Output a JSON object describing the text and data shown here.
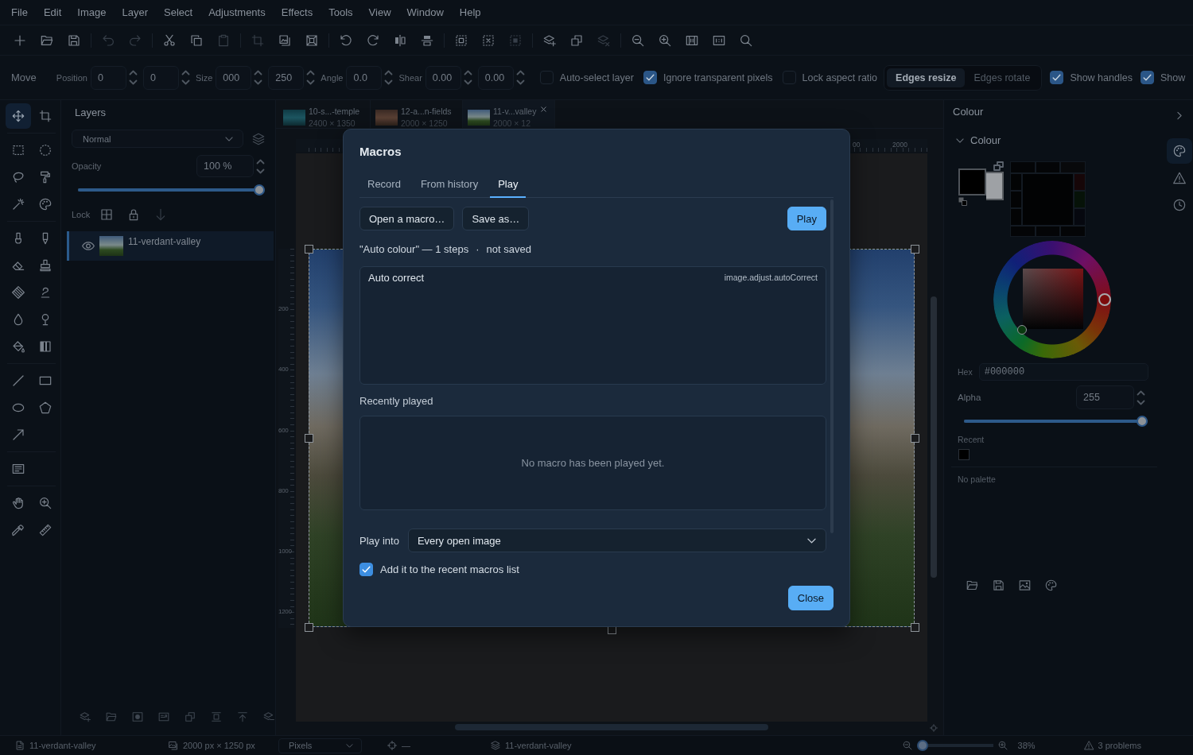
{
  "menu_bar": [
    "File",
    "Edit",
    "Image",
    "Layer",
    "Select",
    "Adjustments",
    "Effects",
    "Tools",
    "View",
    "Window",
    "Help"
  ],
  "toolbar": [
    [
      {
        "disabled": false
      },
      {
        "disabled": false
      },
      {
        "disabled": false
      }
    ],
    [
      {
        "disabled": true
      },
      {
        "disabled": true
      }
    ],
    [
      {
        "disabled": false
      },
      {
        "disabled": false
      },
      {
        "disabled": true
      }
    ],
    [
      {
        "disabled": true
      },
      {
        "disabled": false
      },
      {
        "disabled": false
      }
    ],
    [
      {
        "disabled": false
      },
      {
        "disabled": false
      },
      {
        "disabled": false
      },
      {
        "disabled": false
      }
    ],
    [
      {
        "disabled": false
      },
      {
        "disabled": false
      },
      {
        "disabled": true
      }
    ],
    [
      {
        "disabled": false
      },
      {
        "disabled": false
      },
      {
        "disabled": true
      }
    ],
    [
      {
        "disabled": false
      },
      {
        "disabled": false
      },
      {
        "disabled": false
      },
      {
        "disabled": false
      },
      {
        "disabled": false
      }
    ]
  ],
  "tool_options": {
    "tool": "Move",
    "fields": [
      {
        "label": "Position",
        "value": "0"
      },
      {
        "value": "0"
      },
      {
        "label": "Size",
        "value": "000"
      },
      {
        "value": "250"
      },
      {
        "label": "Angle",
        "value": "0.0"
      },
      {
        "label": "Shear",
        "value": "0.00"
      },
      {
        "value": "0.00"
      }
    ],
    "checks": [
      {
        "label": "Auto-select layer",
        "checked": false
      },
      {
        "label": "Ignore transparent pixels",
        "checked": true
      },
      {
        "label": "Lock aspect ratio",
        "checked": false
      }
    ],
    "edge_modes": [
      {
        "label": "Edges resize",
        "selected": true
      },
      {
        "label": "Edges rotate",
        "selected": false
      }
    ],
    "view_checks": [
      {
        "label": "Show handles",
        "checked": true
      },
      {
        "label": "Show",
        "checked": true
      }
    ]
  },
  "tools": [
    {
      "selected": true
    },
    {
      "selected": false
    },
    {
      "selected": false
    },
    {
      "selected": false
    },
    {
      "selected": false
    },
    {
      "selected": false
    },
    {
      "selected": false
    },
    {
      "selected": false
    },
    {
      "selected": false
    },
    {
      "selected": false
    },
    {
      "selected": false
    },
    {
      "selected": false
    },
    {
      "selected": false
    },
    {
      "selected": false
    },
    {
      "selected": false
    },
    {
      "selected": false
    },
    {
      "selected": false
    },
    {
      "selected": false
    },
    {
      "selected": false
    },
    {
      "selected": false
    },
    {
      "selected": false
    },
    {
      "selected": false
    },
    {
      "selected": false
    },
    {
      "selected": false
    },
    {
      "selected": false
    },
    {
      "selected": false
    },
    {
      "selected": false
    },
    {
      "selected": false
    }
  ],
  "layers_panel": {
    "title": "Layers",
    "blend_mode": "Normal",
    "opacity_label": "Opacity",
    "opacity_value": "100 %",
    "opacity_slider": {
      "level": 1
    },
    "lock_label": "Lock",
    "layers": [
      {
        "name": "11-verdant-valley",
        "selected": true,
        "visible": true
      }
    ]
  },
  "documents": [
    {
      "name": "10-s...-temple",
      "size": "2400 × 1350",
      "selected": false
    },
    {
      "name": "12-a...n-fields",
      "size": "2000 × 1250",
      "selected": false
    },
    {
      "name": "11-v...valley",
      "size": "2000 × 12",
      "selected": true
    }
  ],
  "rulers": {
    "horizontal": [
      "00",
      "2000"
    ],
    "vertical": [
      "200",
      "400",
      "600",
      "800",
      "1000",
      "1200"
    ]
  },
  "colour_panel": {
    "title": "Colour",
    "section": {
      "label": "Colour",
      "expanded": true
    },
    "primary": {
      "color": "#000000"
    },
    "secondary": {
      "color": "#9ea1a5"
    },
    "variations": [
      {
        "color": "#040507"
      },
      {
        "color": "#040507"
      },
      {
        "color": "#08090b"
      },
      {
        "color": "#030405"
      },
      {
        "color": "#030405"
      },
      {
        "color": "#030405"
      },
      {
        "color": "#020304"
      },
      {
        "color": "#160608"
      },
      {
        "color": "#061208"
      },
      {
        "color": "#06080f"
      },
      {
        "color": "#040507"
      },
      {
        "color": "#040507"
      },
      {
        "color": "#040507"
      }
    ],
    "hex_label": "Hex",
    "hex_value": "#000000",
    "alpha_label": "Alpha",
    "alpha_value": "255",
    "alpha_slider": {
      "level": 1
    },
    "recent_label": "Recent",
    "recent": [
      {
        "color": "#000000"
      }
    ],
    "palette_message": "No palette"
  },
  "side_tabs": [
    {
      "selected": true
    },
    {
      "selected": false
    },
    {
      "selected": false
    }
  ],
  "dialog": {
    "title": "Macros",
    "tabs": [
      {
        "label": "Record",
        "selected": false
      },
      {
        "label": "From history",
        "selected": false
      },
      {
        "label": "Play",
        "selected": true
      }
    ],
    "buttons": [
      "Open a macro…",
      "Save as…"
    ],
    "play_button": "Play",
    "macro_name": "\"Auto colour\" — 1 steps",
    "separator": "·",
    "save_state": "not saved",
    "steps": [
      {
        "name": "Auto correct",
        "action": "image.adjust.autoCorrect"
      }
    ],
    "recent_label": "Recently played",
    "recent_empty": "No macro has been played yet.",
    "play_into_label": "Play into",
    "play_into_value": "Every open image",
    "add_to_recent": {
      "label": "Add it to the recent macros list",
      "checked": true
    },
    "close_button": "Close"
  },
  "status_bar": {
    "file": "11-verdant-valley",
    "image_size": "2000 px × 1250 px",
    "unit": "Pixels",
    "cursor": "—",
    "layer": "11-verdant-valley",
    "zoom_slider": {
      "level": 0
    },
    "zoom": "38%",
    "problems": "3 problems"
  }
}
